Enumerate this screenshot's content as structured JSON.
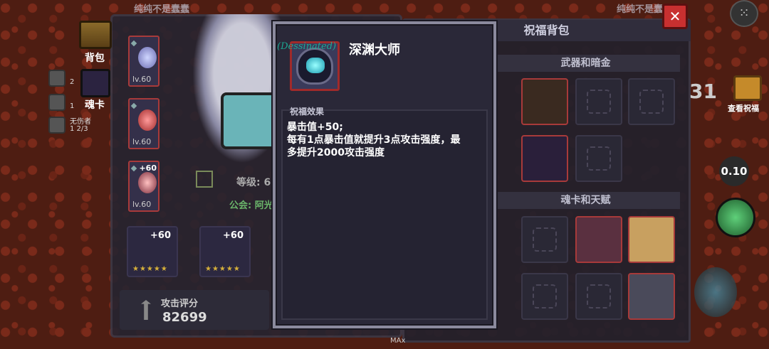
{
  "top": {
    "left_caption": "纯纯不是蠢蠢",
    "right_caption": "纯纯不是蠢蠢",
    "close_symbol": "✕",
    "menu_symbol": "⁙"
  },
  "left_nav": {
    "bag_label": "背包",
    "card_label": "魂卡"
  },
  "mini_stats": [
    {
      "text": "",
      "count": "2"
    },
    {
      "text": "",
      "count": "1"
    },
    {
      "text": "无伤者",
      "count": "1 2/3"
    }
  ],
  "equip_slots": [
    {
      "level": "lv.60"
    },
    {
      "level": "lv.60"
    },
    {
      "level": "lv.60",
      "plus": "+60"
    }
  ],
  "hero": {
    "level_text": "等级: 6",
    "guild_text": "公会: 阿光"
  },
  "bottom_cards": [
    {
      "plus": "+60",
      "stars": "★★★★★"
    },
    {
      "plus": "+60",
      "stars": "★★★★★"
    }
  ],
  "score": {
    "title": "攻击评分",
    "value": "82699"
  },
  "right_panel": {
    "title": "祝福背包",
    "section_weapons": "武器和暗金",
    "section_cards": "魂卡和天赋"
  },
  "side_hud": {
    "big_number": "31",
    "view_bless_label": "查看祝福",
    "speed": "0.10"
  },
  "modal": {
    "name": "深渊大师",
    "watermark": "(Dessinated)",
    "effect_label": "祝福效果",
    "desc_lines": [
      "暴击值+50;",
      "每有1点暴击值就提升3点攻击强度，最",
      "多提升2000攻击强度"
    ]
  },
  "bottom_tag": "MAx",
  "colors": {
    "slot_border_red": "#a83a3a",
    "close_red": "#c83030",
    "watermark_teal": "#1bb39a"
  }
}
